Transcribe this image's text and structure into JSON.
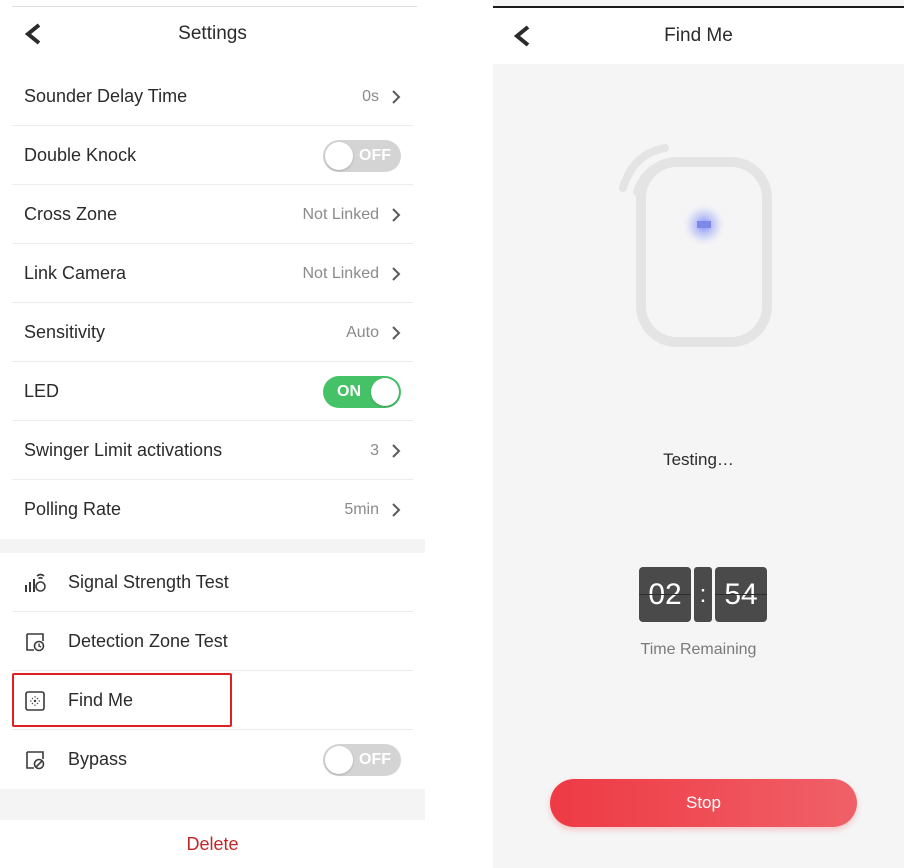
{
  "left": {
    "title": "Settings",
    "rows": [
      {
        "label": "Sounder Delay Time",
        "value": "0s"
      },
      {
        "label": "Double Knock",
        "toggle": "OFF"
      },
      {
        "label": "Cross Zone",
        "value": "Not Linked"
      },
      {
        "label": "Link Camera",
        "value": "Not Linked"
      },
      {
        "label": "Sensitivity",
        "value": "Auto"
      },
      {
        "label": "LED",
        "toggle": "ON"
      },
      {
        "label": "Swinger Limit activations",
        "value": "3"
      },
      {
        "label": "Polling Rate",
        "value": "5min"
      }
    ],
    "tests": [
      {
        "label": "Signal Strength Test",
        "icon": "signal-strength-icon"
      },
      {
        "label": "Detection Zone Test",
        "icon": "detection-zone-icon"
      },
      {
        "label": "Find Me",
        "icon": "find-me-icon"
      },
      {
        "label": "Bypass",
        "icon": "bypass-icon",
        "toggle": "OFF"
      }
    ],
    "delete_label": "Delete"
  },
  "right": {
    "title": "Find Me",
    "status": "Testing…",
    "timer": {
      "minutes": "02",
      "seconds": "54",
      "separator": ":"
    },
    "timer_label": "Time Remaining",
    "stop_label": "Stop"
  },
  "colors": {
    "accent_red": "#ee3a44",
    "toggle_on": "#45c267",
    "toggle_off": "#d4d4d4",
    "delete_text": "#c0282a",
    "highlight_border": "#e02020"
  }
}
